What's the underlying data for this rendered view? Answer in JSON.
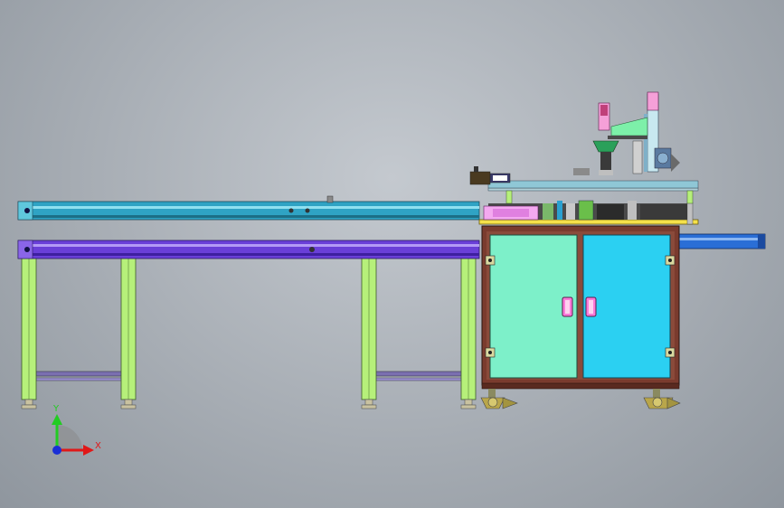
{
  "viewport": {
    "background_top": "#c4c9cf",
    "background_bottom": "#8f969e"
  },
  "triad": {
    "x_label": "X",
    "y_label": "Y",
    "x_color": "#e01818",
    "y_color": "#22cc22",
    "z_color": "#1a2fd6"
  },
  "colors": {
    "upper_rail": "#2fa3c4",
    "lower_rail": "#6a3fd8",
    "legs": "#b6f07a",
    "cabinet_frame": "#7a3b2e",
    "door_left": "#7df0c9",
    "door_right": "#2bd0f2",
    "handle": "#ff7ad9",
    "table_top": "#f5e14a",
    "outfeed": "#2a6ed6",
    "feet": "#b9a64a"
  }
}
